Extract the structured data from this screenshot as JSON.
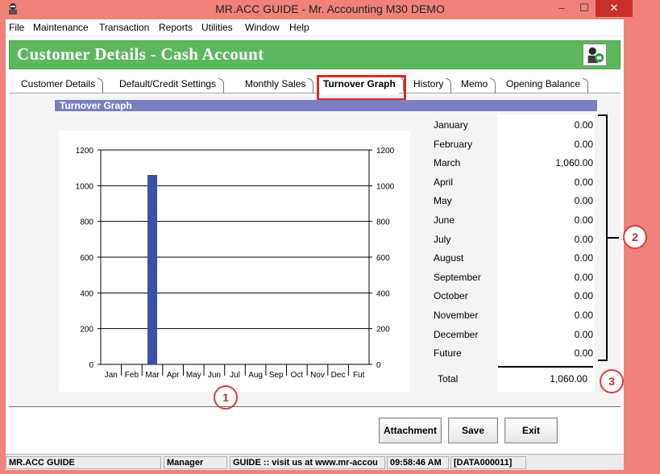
{
  "window": {
    "title": "MR.ACC GUIDE - Mr. Accounting M30 DEMO",
    "minimize": "–",
    "maximize": "☐",
    "close": "✕"
  },
  "menu": [
    "File",
    "Maintenance",
    "Transaction",
    "Reports",
    "Utilities",
    "Window",
    "Help"
  ],
  "header": {
    "title": "Customer Details  -  Cash Account"
  },
  "tabs": [
    "Customer Details",
    "Default/Credit Settings",
    "Monthly Sales",
    "Turnover Graph",
    "History",
    "Memo",
    "Opening Balance"
  ],
  "active_tab": "Turnover Graph",
  "section": {
    "title": "Turnover Graph"
  },
  "months": [
    {
      "name": "January",
      "value": "0.00"
    },
    {
      "name": "February",
      "value": "0.00"
    },
    {
      "name": "March",
      "value": "1,060.00"
    },
    {
      "name": "April",
      "value": "0.00"
    },
    {
      "name": "May",
      "value": "0.00"
    },
    {
      "name": "June",
      "value": "0.00"
    },
    {
      "name": "July",
      "value": "0.00"
    },
    {
      "name": "August",
      "value": "0.00"
    },
    {
      "name": "September",
      "value": "0.00"
    },
    {
      "name": "October",
      "value": "0.00"
    },
    {
      "name": "November",
      "value": "0.00"
    },
    {
      "name": "December",
      "value": "0.00"
    },
    {
      "name": "Future",
      "value": "0.00"
    }
  ],
  "total": {
    "label": "Total",
    "value": "1,060.00"
  },
  "callouts": [
    "1",
    "2",
    "3"
  ],
  "buttons": {
    "attachment": "Attachment",
    "save": "Save",
    "exit": "Exit"
  },
  "status": [
    "MR.ACC GUIDE",
    "Manager",
    "GUIDE  :: visit us at www.mr-accou",
    "09:58:46 AM",
    "[DATA000011]"
  ],
  "colors": {
    "bar": "#3b51a3",
    "header": "#5cb85c",
    "section": "#7b7fc2",
    "callout": "#e13b3b"
  },
  "chart_data": {
    "type": "bar",
    "categories": [
      "Jan",
      "Feb",
      "Mar",
      "Apr",
      "May",
      "Jun",
      "Jul",
      "Aug",
      "Sep",
      "Oct",
      "Nov",
      "Dec",
      "Fut"
    ],
    "values": [
      0,
      0,
      1060,
      0,
      0,
      0,
      0,
      0,
      0,
      0,
      0,
      0,
      0
    ],
    "yticks": [
      0,
      200,
      400,
      600,
      800,
      1000,
      1200
    ],
    "ylim": [
      0,
      1200
    ],
    "grid": true,
    "title": "",
    "xlabel": "",
    "ylabel": ""
  }
}
